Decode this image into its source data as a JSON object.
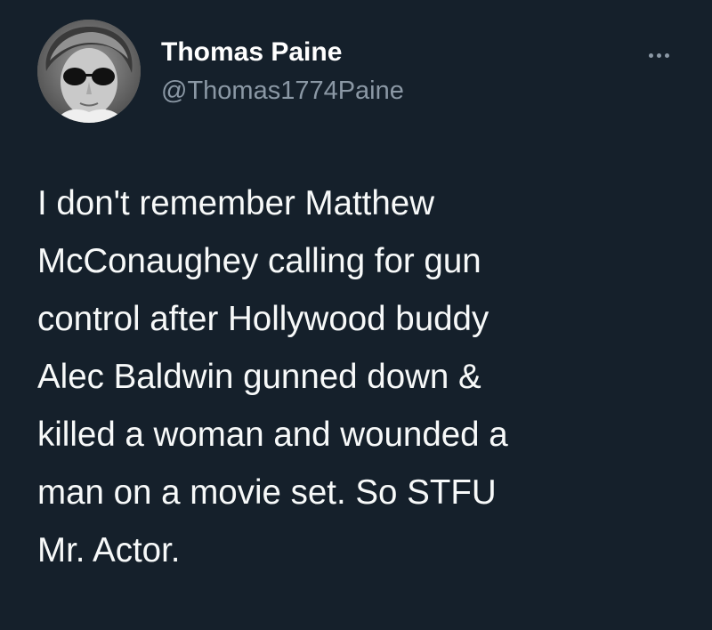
{
  "tweet": {
    "author": {
      "display_name": "Thomas Paine",
      "handle": "@Thomas1774Paine"
    },
    "text_lines": [
      "I don't remember Matthew",
      "McConaughey calling for gun",
      "control after Hollywood buddy",
      "Alec Baldwin gunned down &",
      "killed a woman and wounded a",
      "man on a movie set. So STFU",
      "Mr. Actor."
    ]
  },
  "icons": {
    "more": "more-options-icon",
    "avatar": "avatar"
  },
  "colors": {
    "background": "#15202b",
    "primary_text": "#f7f9f9",
    "secondary_text": "#8b98a5"
  }
}
